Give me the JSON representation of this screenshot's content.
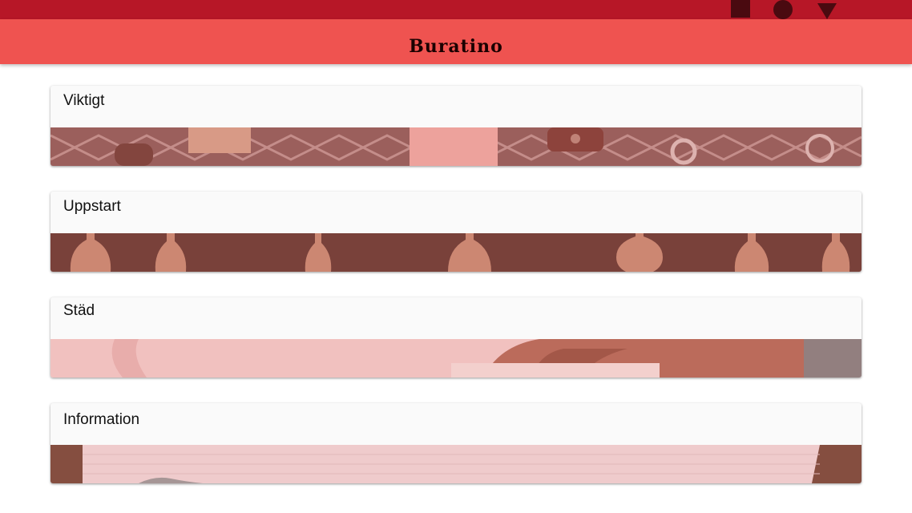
{
  "app": {
    "title": "Buratino"
  },
  "colors": {
    "status_bar": "#b71727",
    "app_bar": "#ef5350",
    "card_background": "#fafafa"
  },
  "status_icons": [
    "square-icon",
    "circle-icon",
    "triangle-icon"
  ],
  "cards": [
    {
      "title": "Viktigt",
      "image": "padlocks-photo"
    },
    {
      "title": "Uppstart",
      "image": "light-bulbs-photo"
    },
    {
      "title": "Städ",
      "image": "cleaning-photo"
    },
    {
      "title": "Information",
      "image": "notebook-photo"
    }
  ]
}
